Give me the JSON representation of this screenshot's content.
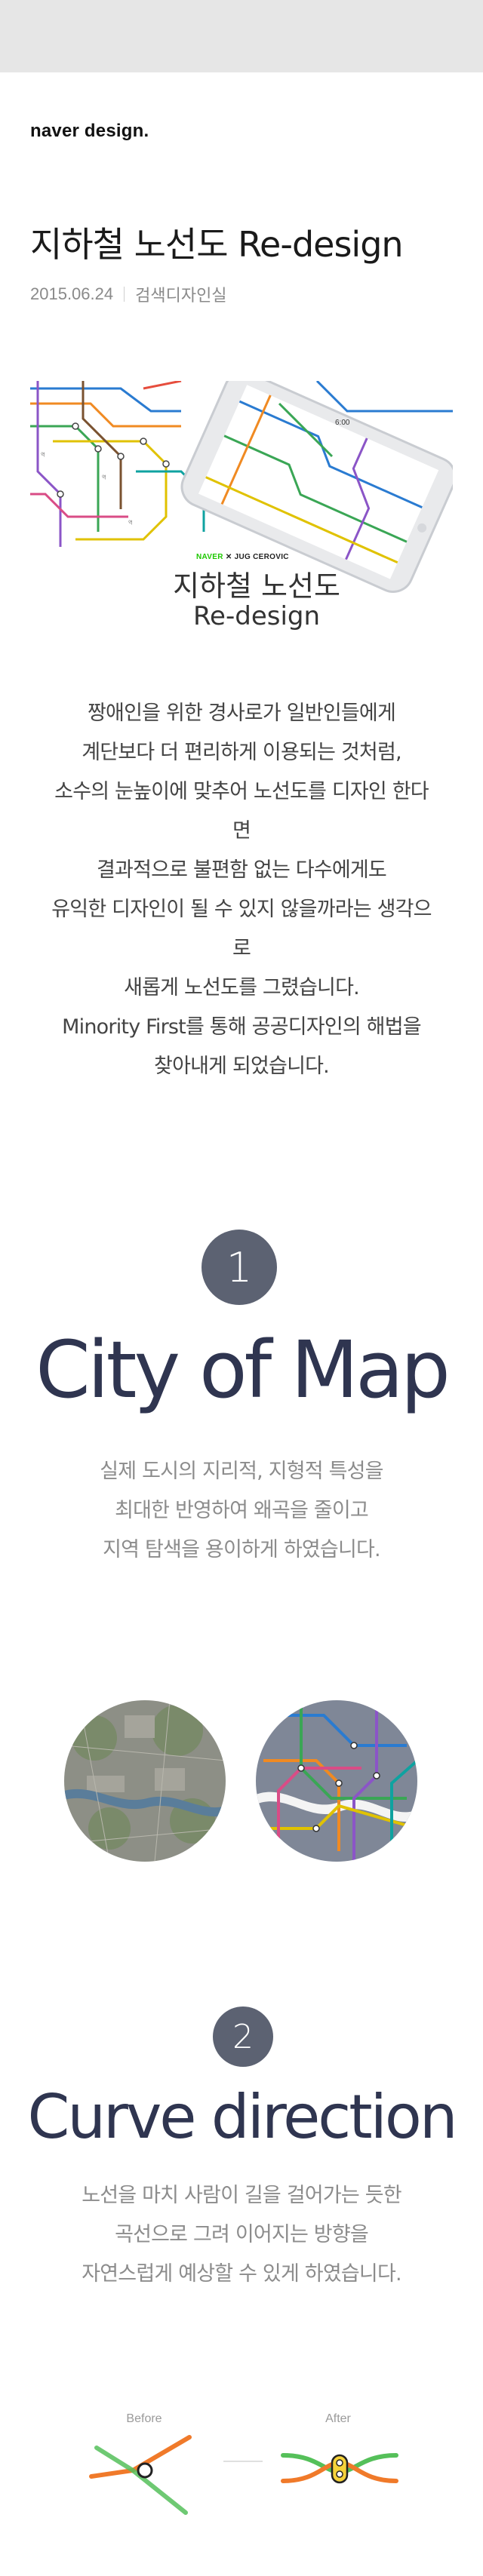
{
  "brand": {
    "name": "naver design",
    "dot": "."
  },
  "article": {
    "title": "지하철 노선도 Re-design",
    "date": "2015.06.24",
    "category": "검색디자인실"
  },
  "hero": {
    "badge_naver": "NAVER",
    "badge_x": " ✕ ",
    "badge_partner": "JUG CEROVIC",
    "title_line1": "지하철 노선도",
    "title_line2": "Re-design"
  },
  "intro": {
    "lines": [
      "짱애인을 위한 경사로가 일반인들에게",
      "계단보다 더 편리하게 이용되는 것처럼,",
      "소수의 눈높이에 맞추어 노선도를 디자인 한다",
      "면",
      "결과적으로 불편함 없는 다수에게도",
      "유익한 디자인이 될 수 있지 않을까라는 생각으",
      "로",
      "새롭게 노선도를 그렸습니다.",
      "Minority First를 통해 공공디자인의 해법을",
      "찾아내게 되었습니다."
    ]
  },
  "section1": {
    "number": "1",
    "title": "City of Map",
    "lines": [
      "실제 도시의 지리적, 지형적 특성을",
      "최대한 반영하여 왜곡을 줄이고",
      "지역 탐색을 용이하게 하였습니다."
    ],
    "images": [
      "map-satellite-image",
      "map-subway-overlay-image"
    ]
  },
  "section2": {
    "number": "2",
    "title": "Curve direction",
    "lines": [
      "노선을 마치 사람이 길을 걸어가는 듯한",
      "곡선으로 그려 이어지는 방향을",
      "자연스럽게 예상할 수 있게 하였습니다."
    ],
    "before_label": "Before",
    "after_label": "After"
  },
  "colors": {
    "topbar": "#e6e6e6",
    "number_circle": "#5c6272",
    "section_title": "#2f3550",
    "naver_green": "#1ec800",
    "line_orange": "#f07a2a",
    "line_green": "#55c05a"
  }
}
